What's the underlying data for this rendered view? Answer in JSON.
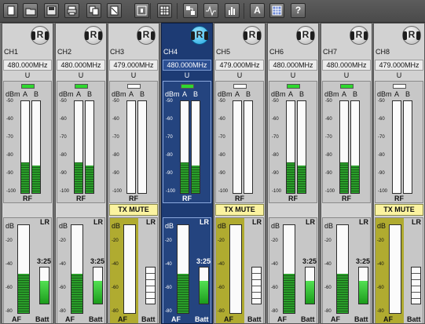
{
  "toolbar": {
    "buttons": [
      {
        "name": "new-icon"
      },
      {
        "name": "open-icon"
      },
      {
        "name": "save-icon"
      },
      {
        "name": "print-icon"
      },
      {
        "name": "copy-icon"
      },
      {
        "name": "cut-icon"
      },
      {
        "name": "fit-icon"
      },
      {
        "name": "grid-icon"
      },
      {
        "name": "layout-icon"
      },
      {
        "name": "scan-icon"
      },
      {
        "name": "bars-icon"
      },
      {
        "name": "font-icon",
        "glyph": "A"
      },
      {
        "name": "table-icon"
      },
      {
        "name": "help-icon",
        "glyph": "?"
      }
    ]
  },
  "labels": {
    "dbm": "dBm",
    "a": "A",
    "b": "B",
    "rf": "RF",
    "db": "dB",
    "lr": "LR",
    "af": "AF",
    "batt": "Batt",
    "tx_mute": "TX MUTE",
    "logo_letter": "R"
  },
  "rf_scale": [
    "-50",
    "-60",
    "-70",
    "-80",
    "-90",
    "-100"
  ],
  "af_scale": [
    "-20",
    "-40",
    "-60",
    "-80"
  ],
  "channels": [
    {
      "name": "CH1",
      "freq": "480.000MHz",
      "group": "U",
      "diode_on": true,
      "selected": false,
      "muted": false,
      "rf_a": 0.33,
      "rf_b": 0.3,
      "af": 0.45,
      "time": "3:25",
      "batt": 0.62
    },
    {
      "name": "CH2",
      "freq": "480.000MHz",
      "group": "U",
      "diode_on": true,
      "selected": false,
      "muted": false,
      "rf_a": 0.33,
      "rf_b": 0.3,
      "af": 0.45,
      "time": "3:25",
      "batt": 0.62
    },
    {
      "name": "CH3",
      "freq": "479.000MHz",
      "group": "U",
      "diode_on": false,
      "selected": false,
      "muted": true,
      "rf_a": 0.0,
      "rf_b": 0.0,
      "af": 0.0,
      "time": "",
      "batt": 0.0
    },
    {
      "name": "CH4",
      "freq": "480.000MHz",
      "group": "U",
      "diode_on": true,
      "selected": true,
      "muted": false,
      "rf_a": 0.33,
      "rf_b": 0.3,
      "af": 0.45,
      "time": "3:25",
      "batt": 0.62
    },
    {
      "name": "CH5",
      "freq": "479.000MHz",
      "group": "U",
      "diode_on": false,
      "selected": false,
      "muted": true,
      "rf_a": 0.0,
      "rf_b": 0.0,
      "af": 0.0,
      "time": "",
      "batt": 0.0
    },
    {
      "name": "CH6",
      "freq": "480.000MHz",
      "group": "U",
      "diode_on": true,
      "selected": false,
      "muted": false,
      "rf_a": 0.33,
      "rf_b": 0.3,
      "af": 0.45,
      "time": "3:25",
      "batt": 0.62
    },
    {
      "name": "CH7",
      "freq": "480.000MHz",
      "group": "U",
      "diode_on": true,
      "selected": false,
      "muted": false,
      "rf_a": 0.33,
      "rf_b": 0.3,
      "af": 0.45,
      "time": "3:25",
      "batt": 0.62
    },
    {
      "name": "CH8",
      "freq": "479.000MHz",
      "group": "U",
      "diode_on": false,
      "selected": false,
      "muted": true,
      "rf_a": 0.0,
      "rf_b": 0.0,
      "af": 0.0,
      "time": "",
      "batt": 0.0
    }
  ]
}
